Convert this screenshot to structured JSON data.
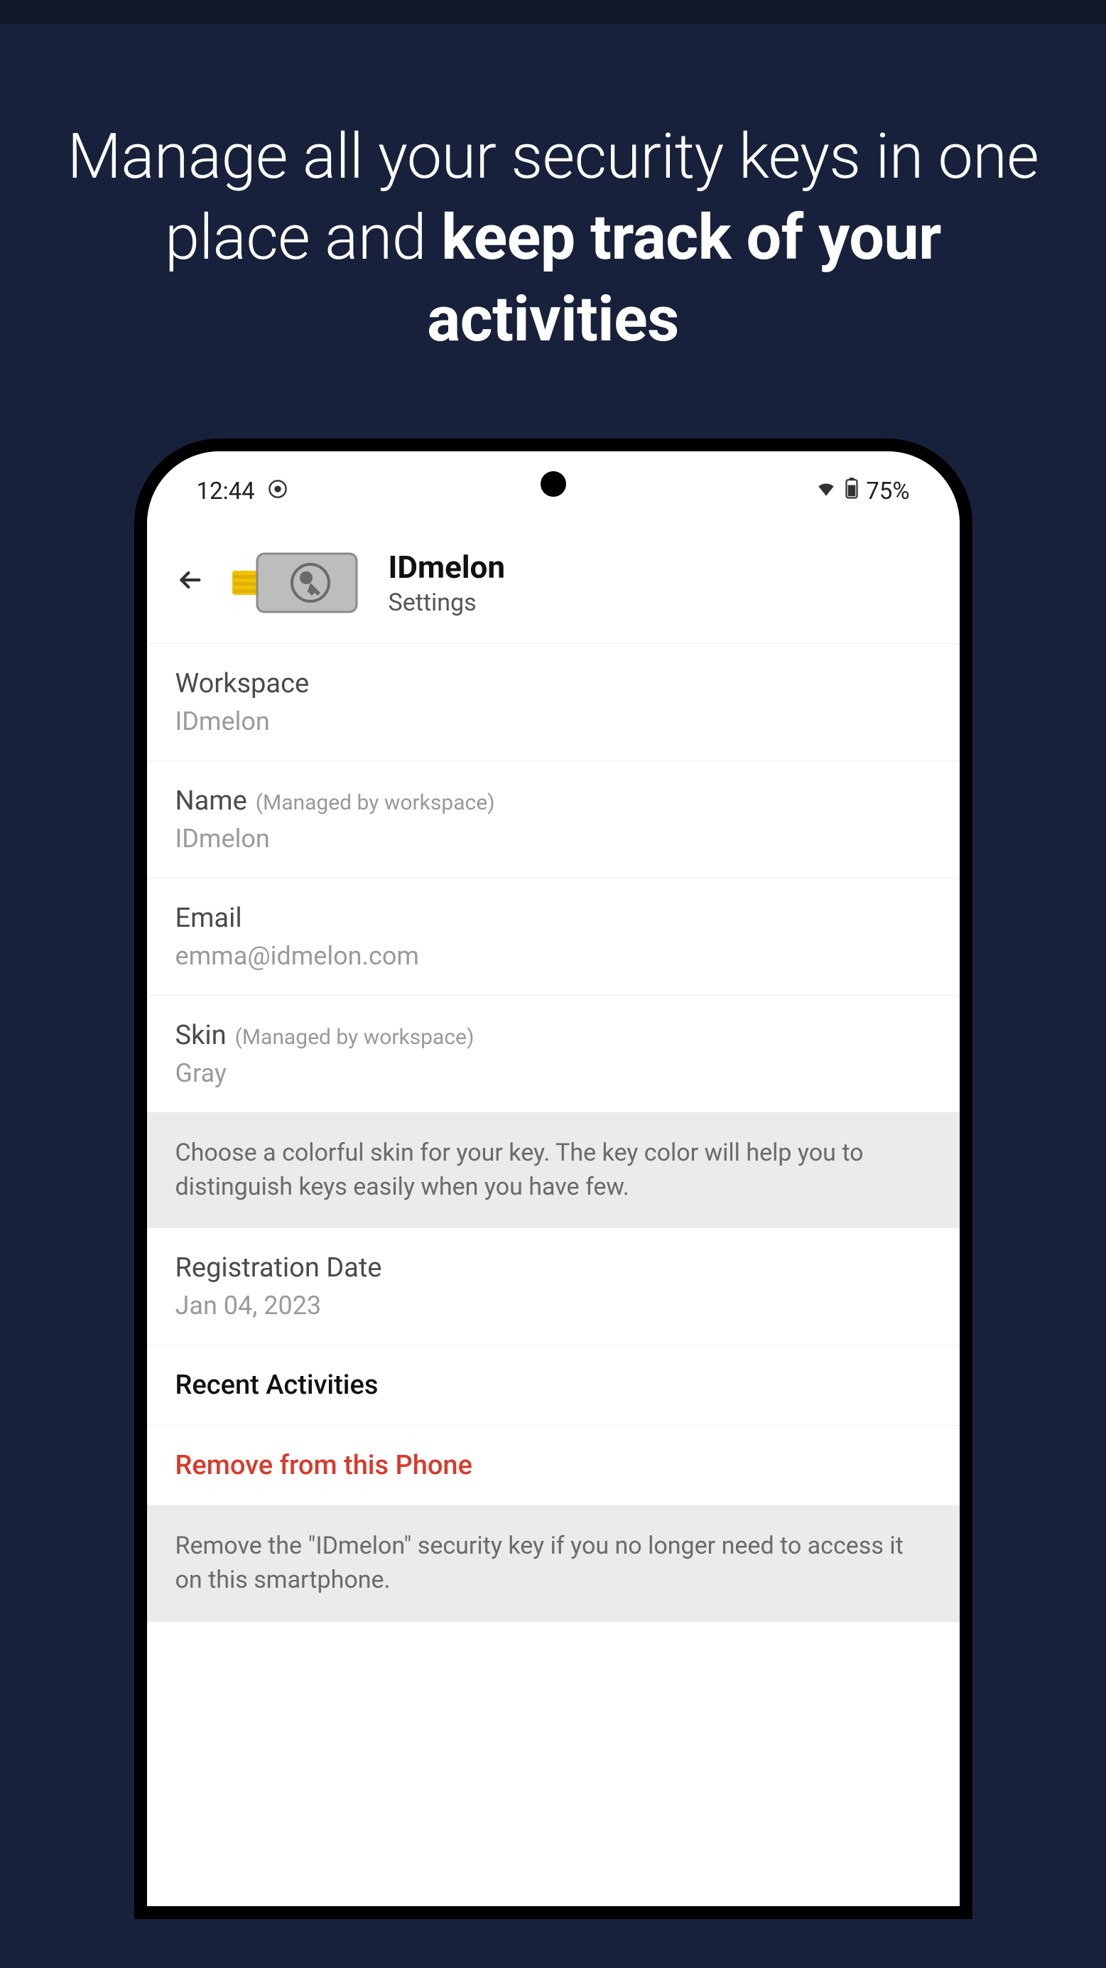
{
  "hero": {
    "line_plain_1": "Manage all your security keys in one",
    "line_plain_2": "place and ",
    "line_bold": "keep track of your activities"
  },
  "statusbar": {
    "time": "12:44",
    "battery": "75%"
  },
  "header": {
    "title": "IDmelon",
    "subtitle": "Settings"
  },
  "rows": {
    "workspace": {
      "label": "Workspace",
      "value": "IDmelon"
    },
    "name": {
      "label": "Name",
      "hint": "(Managed by workspace)",
      "value": "IDmelon"
    },
    "email": {
      "label": "Email",
      "value": "emma@idmelon.com"
    },
    "skin": {
      "label": "Skin",
      "hint": "(Managed by workspace)",
      "value": "Gray"
    },
    "skin_info": "Choose a colorful skin for your key. The key color will help you to distinguish keys easily when you have few.",
    "regdate": {
      "label": "Registration Date",
      "value": "Jan 04, 2023"
    },
    "recent": {
      "label": "Recent Activities"
    },
    "remove": {
      "label": "Remove from this Phone"
    },
    "remove_info": "Remove the \"IDmelon\" security key if you no longer need to access it on this smartphone."
  }
}
